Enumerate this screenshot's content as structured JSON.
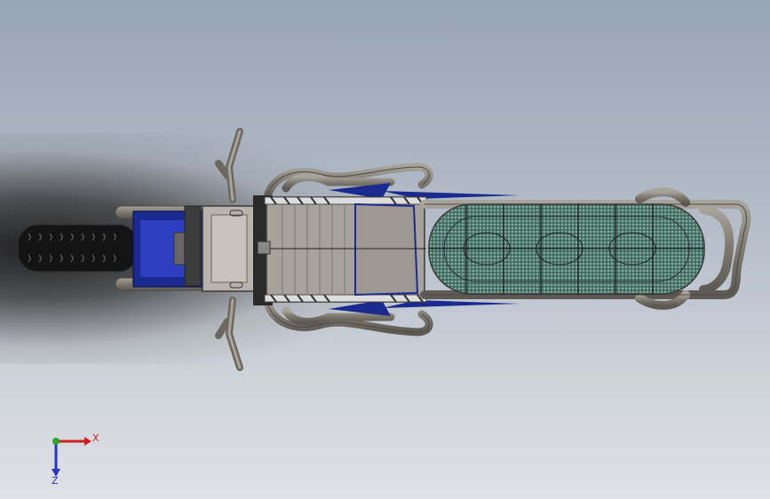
{
  "viewport": {
    "background_top": "#98a5b5",
    "background_bottom": "#dfe2e6"
  },
  "model": {
    "frame_color": "#8c877f",
    "tank_color": "#1b2a8f",
    "panel_color": "#b8b4ad",
    "mesh_color": "#5e8a7c"
  },
  "triad": {
    "x_label": "X",
    "z_label": "Z",
    "x_color": "#d11f1f",
    "y_color": "#2aa42a",
    "z_color": "#2735c6"
  }
}
